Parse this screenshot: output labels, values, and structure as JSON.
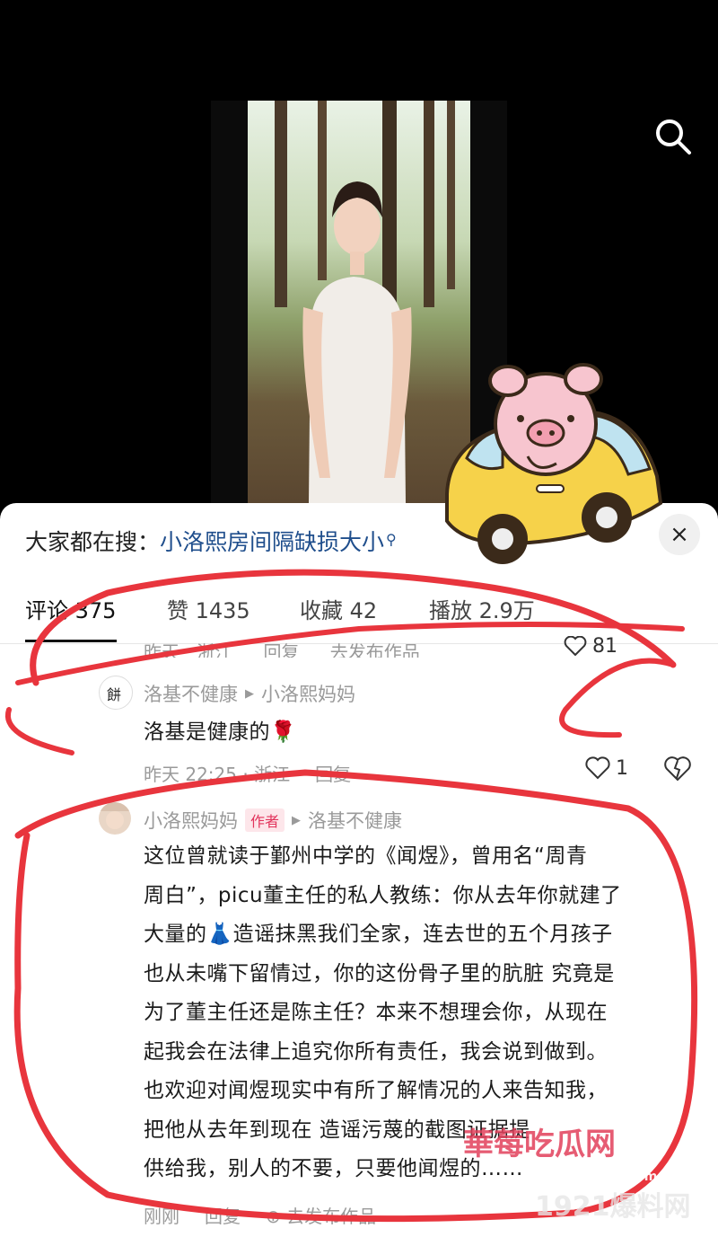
{
  "colors": {
    "accent_red": "#e2345c",
    "link_blue": "#1f4e8c",
    "muted": "#9a9a9a"
  },
  "header": {
    "search_icon": "search-icon"
  },
  "search_bar": {
    "prefix": "大家都在搜：",
    "query": "小洛熙房间隔缺损大小",
    "close_label": "×"
  },
  "tabs": [
    {
      "label": "评论 375",
      "active": true
    },
    {
      "label": "赞 1435",
      "active": false
    },
    {
      "label": "收藏 42",
      "active": false
    },
    {
      "label": "播放 2.9万",
      "active": false
    }
  ],
  "prev_comment": {
    "time": "昨天 · 浙江",
    "reply": "回复",
    "publish": "去发布作品",
    "likes": "81"
  },
  "comments": [
    {
      "user": "洛基不健康",
      "reply_to": "小洛熙妈妈",
      "text": "洛基是健康的🌹",
      "time": "昨天 22:25 · 浙江",
      "reply": "回复",
      "likes": "1"
    },
    {
      "user": "小洛熙妈妈",
      "badge": "作者",
      "reply_to": "洛基不健康",
      "lines": [
        "这位曾就读于鄞州中学的《闻煜》，曾用名“周青",
        "周白”，picu董主任的私人教练：你从去年你就建了",
        "大量的👗造谣抹黑我们全家，连去世的五个月孩子",
        "也从未嘴下留情过，你的这份骨子里的肮脏 究竟是",
        "为了董主任还是陈主任？本来不想理会你，从现在",
        "起我会在法律上追究你所有责任，我会说到做到。",
        "也欢迎对闻煜现实中有所了解情况的人来告知我，",
        "把他从去年到现在 造谣污蔑的截图证据提",
        "供给我，别人的不要，只要他闻煜的……"
      ],
      "time": "刚刚",
      "reply": "回复",
      "publish": "去发布作品"
    }
  ],
  "watermarks": {
    "top": "華莓吃瓜网",
    "url": "www.cmcgw.com",
    "bottom": "1921爆料网"
  }
}
